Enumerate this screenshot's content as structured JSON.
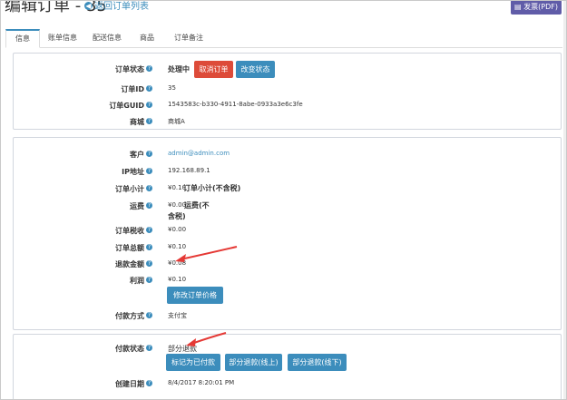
{
  "header": {
    "title": "编辑订单 - 35",
    "back_label": "返回订单列表",
    "pdf_label": "发票(PDF)"
  },
  "tabs": [
    {
      "label": "信息",
      "active": true
    },
    {
      "label": "账单信息"
    },
    {
      "label": "配送信息"
    },
    {
      "label": "商品"
    },
    {
      "label": "订单备注"
    }
  ],
  "order": {
    "status_label": "订单状态",
    "status_value": "处理中",
    "cancel_button": "取消订单",
    "change_status_button": "改变状态",
    "id_label": "订单ID",
    "id_value": "35",
    "guid_label": "订单GUID",
    "guid_value": "1543583c-b330-4911-8abe-0933a3e6c3fe",
    "store_label": "商城",
    "store_value": "商城A"
  },
  "totals": {
    "customer_label": "客户",
    "customer_value": "admin@admin.com",
    "ip_label": "IP地址",
    "ip_value": "192.168.89.1",
    "subtotal_label": "订单小计",
    "subtotal_amount": "¥0.10",
    "subtotal_note": "订单小计(不含税)",
    "shipping_label": "运费",
    "shipping_amount": "¥0.00",
    "shipping_note_1": "运费(不",
    "shipping_note_2": "含税)",
    "tax_label": "订单税收",
    "tax_value": "¥0.00",
    "total_label": "订单总额",
    "total_value": "¥0.10",
    "refund_label": "退款金额",
    "refund_value": "¥0.08",
    "profit_label": "利润",
    "profit_value": "¥0.10",
    "edit_totals_button": "修改订单价格",
    "payment_method_label": "付款方式",
    "payment_method_value": "支付宝"
  },
  "payment": {
    "status_label": "付款状态",
    "status_value": "部分退款",
    "mark_paid_button": "标记为已付款",
    "partial_refund_online_button": "部分退款(线上)",
    "partial_refund_offline_button": "部分退款(线下)",
    "created_label": "创建日期",
    "created_value": "8/4/2017 8:20:01 PM"
  },
  "colors": {
    "primary": "#3c8dbc",
    "danger": "#dd4b39",
    "pdf": "#605ca8",
    "annotation": "#e53935"
  },
  "icons": {
    "help": "help-icon",
    "back": "back-circle-icon",
    "pdf": "pdf-icon"
  }
}
